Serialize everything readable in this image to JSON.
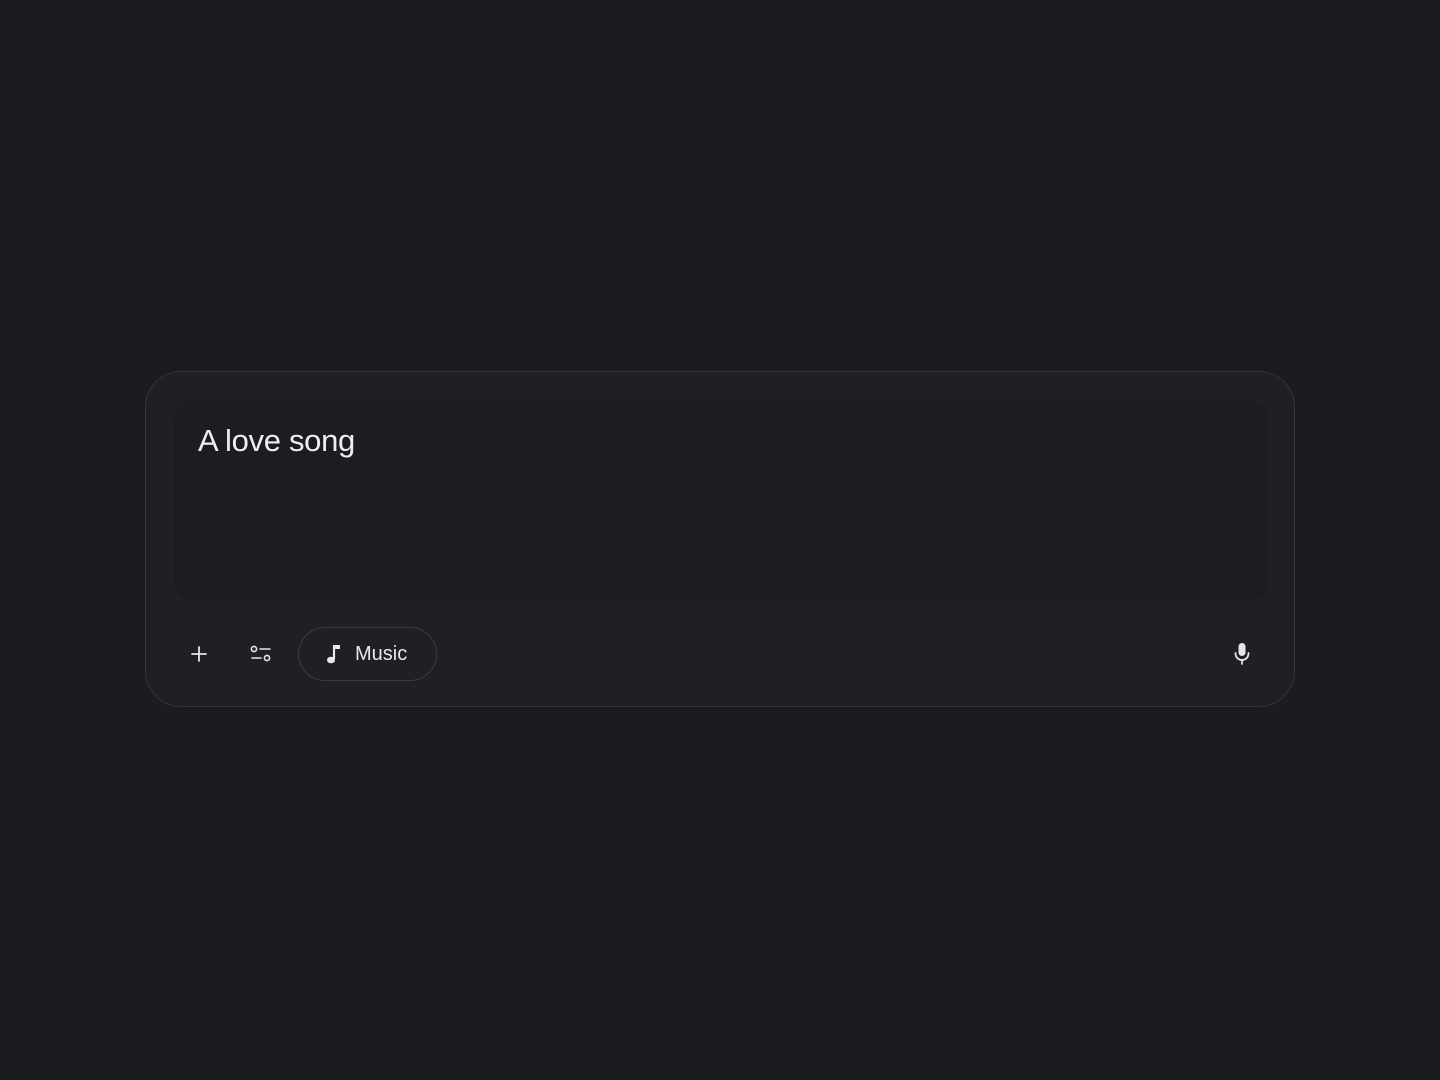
{
  "composer": {
    "prompt_text": "A love song",
    "chip_label": "Music"
  },
  "icons": {
    "add": "plus-icon",
    "tools": "tune-icon",
    "chip": "music-note-icon",
    "mic": "microphone-icon"
  },
  "colors": {
    "background": "#1b1c20",
    "panel": "#1f2024",
    "text": "#eeeeee"
  }
}
